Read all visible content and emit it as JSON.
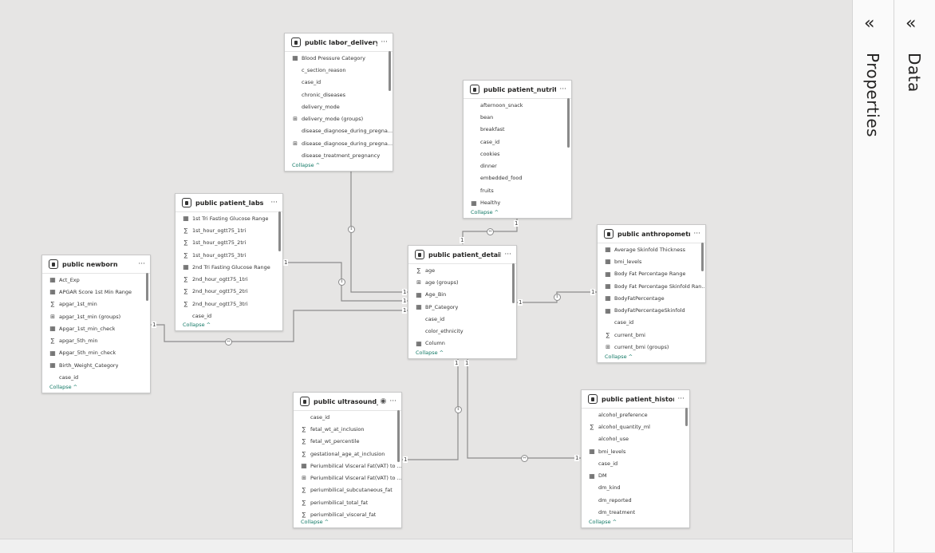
{
  "panes": {
    "properties": {
      "label": "Properties",
      "collapse_icon": "double-chevron-left-icon",
      "collapse_glyph": "«"
    },
    "data": {
      "label": "Data",
      "collapse_icon": "double-chevron-left-icon",
      "collapse_glyph": "«"
    }
  },
  "collapse_label": "Collapse",
  "collapse_glyph": "^",
  "more_glyph": "···",
  "relationship_labels": {
    "one": "1"
  },
  "tables": {
    "labor_delivery": {
      "title": "public labor_delivery",
      "fields": [
        {
          "name": "Blood Pressure Category",
          "icon": "calculated-column-icon"
        },
        {
          "name": "c_section_reason",
          "icon": "none"
        },
        {
          "name": "case_id",
          "icon": "none"
        },
        {
          "name": "chronic_diseases",
          "icon": "none"
        },
        {
          "name": "delivery_mode",
          "icon": "none"
        },
        {
          "name": "delivery_mode (groups)",
          "icon": "group-icon"
        },
        {
          "name": "disease_diagnose_during_pregna...",
          "icon": "none"
        },
        {
          "name": "disease_diagnose_during_pregna...",
          "icon": "group-icon"
        },
        {
          "name": "disease_treatment_pregnancy",
          "icon": "none"
        }
      ]
    },
    "patient_nutrition": {
      "title": "public patient_nutrition",
      "fields": [
        {
          "name": "afternoon_snack",
          "icon": "none"
        },
        {
          "name": "bean",
          "icon": "none"
        },
        {
          "name": "breakfast",
          "icon": "none"
        },
        {
          "name": "case_id",
          "icon": "none"
        },
        {
          "name": "cookies",
          "icon": "none"
        },
        {
          "name": "dinner",
          "icon": "none"
        },
        {
          "name": "embedded_food",
          "icon": "none"
        },
        {
          "name": "fruits",
          "icon": "none"
        },
        {
          "name": "Healthy",
          "icon": "calculated-column-icon"
        }
      ]
    },
    "patient_labs": {
      "title": "public patient_labs",
      "fields": [
        {
          "name": "1st Tri Fasting Glucose Range",
          "icon": "calculated-column-icon"
        },
        {
          "name": "1st_hour_ogtt75_1tri",
          "icon": "sigma-icon"
        },
        {
          "name": "1st_hour_ogtt75_2tri",
          "icon": "sigma-icon"
        },
        {
          "name": "1st_hour_ogtt75_3tri",
          "icon": "sigma-icon"
        },
        {
          "name": "2nd Tri Fasting Glucose Range",
          "icon": "calculated-column-icon"
        },
        {
          "name": "2nd_hour_ogtt75_1tri",
          "icon": "sigma-icon"
        },
        {
          "name": "2nd_hour_ogtt75_2tri",
          "icon": "sigma-icon"
        },
        {
          "name": "2nd_hour_ogtt75_3tri",
          "icon": "sigma-icon"
        },
        {
          "name": "case_id",
          "icon": "none"
        }
      ]
    },
    "newborn": {
      "title": "public newborn",
      "fields": [
        {
          "name": "Act_Exp",
          "icon": "calculated-column-icon"
        },
        {
          "name": "APGAR Score 1st Min Range",
          "icon": "calculated-column-icon"
        },
        {
          "name": "apgar_1st_min",
          "icon": "sigma-icon"
        },
        {
          "name": "apgar_1st_min (groups)",
          "icon": "group-icon"
        },
        {
          "name": "Apgar_1st_min_check",
          "icon": "calculated-column-icon"
        },
        {
          "name": "apgar_5th_min",
          "icon": "sigma-icon"
        },
        {
          "name": "Apgar_5th_min_check",
          "icon": "calculated-column-icon"
        },
        {
          "name": "Birth_Weight_Category",
          "icon": "calculated-column-icon"
        },
        {
          "name": "case_id",
          "icon": "none"
        }
      ]
    },
    "patient_details": {
      "title": "public patient_details",
      "fields": [
        {
          "name": "age",
          "icon": "sigma-icon"
        },
        {
          "name": "age (groups)",
          "icon": "group-icon"
        },
        {
          "name": "Age_Bin",
          "icon": "calculated-column-icon"
        },
        {
          "name": "BP_Category",
          "icon": "calculated-column-icon"
        },
        {
          "name": "case_id",
          "icon": "none"
        },
        {
          "name": "color_ethnicity",
          "icon": "none"
        },
        {
          "name": "Column",
          "icon": "calculated-column-icon"
        }
      ]
    },
    "anthropometry": {
      "title": "public anthropometry",
      "fields": [
        {
          "name": "Average Skinfold Thickness",
          "icon": "calculated-column-icon"
        },
        {
          "name": "bmi_levels",
          "icon": "calculated-column-icon"
        },
        {
          "name": "Body Fat Percentage Range",
          "icon": "calculated-column-icon"
        },
        {
          "name": "Body Fat Percentage Skinfold Ran...",
          "icon": "calculated-column-icon"
        },
        {
          "name": "BodyFatPercentage",
          "icon": "calculated-column-icon"
        },
        {
          "name": "BodyFatPercentageSkinfold",
          "icon": "calculated-column-icon"
        },
        {
          "name": "case_id",
          "icon": "none"
        },
        {
          "name": "current_bmi",
          "icon": "sigma-icon"
        },
        {
          "name": "current_bmi (groups)",
          "icon": "group-icon"
        }
      ]
    },
    "ultrasound": {
      "title": "public ultrasound_r...",
      "fields": [
        {
          "name": "case_id",
          "icon": "none"
        },
        {
          "name": "fetal_wt_at_inclusion",
          "icon": "sigma-icon"
        },
        {
          "name": "fetal_wt_percentile",
          "icon": "sigma-icon"
        },
        {
          "name": "gestational_age_at_inclusion",
          "icon": "sigma-icon"
        },
        {
          "name": "Periumbilical Visceral Fat(VAT) to ...",
          "icon": "calculated-column-icon"
        },
        {
          "name": "Periumbilical Visceral Fat(VAT) to ...",
          "icon": "group-icon"
        },
        {
          "name": "periumbilical_subcutaneous_fat",
          "icon": "sigma-icon"
        },
        {
          "name": "periumbilical_total_fat",
          "icon": "sigma-icon"
        },
        {
          "name": "periumbilical_visceral_fat",
          "icon": "sigma-icon"
        }
      ]
    },
    "patient_history": {
      "title": "public patient_history",
      "fields": [
        {
          "name": "alcohol_preference",
          "icon": "none"
        },
        {
          "name": "alcohol_quantity_ml",
          "icon": "sigma-icon"
        },
        {
          "name": "alcohol_use",
          "icon": "none"
        },
        {
          "name": "bmi_levels",
          "icon": "calculated-column-icon"
        },
        {
          "name": "case_id",
          "icon": "none"
        },
        {
          "name": "DM",
          "icon": "calculated-column-icon"
        },
        {
          "name": "dm_kind",
          "icon": "none"
        },
        {
          "name": "dm_reported",
          "icon": "none"
        },
        {
          "name": "dm_treatment",
          "icon": "none"
        }
      ]
    }
  }
}
